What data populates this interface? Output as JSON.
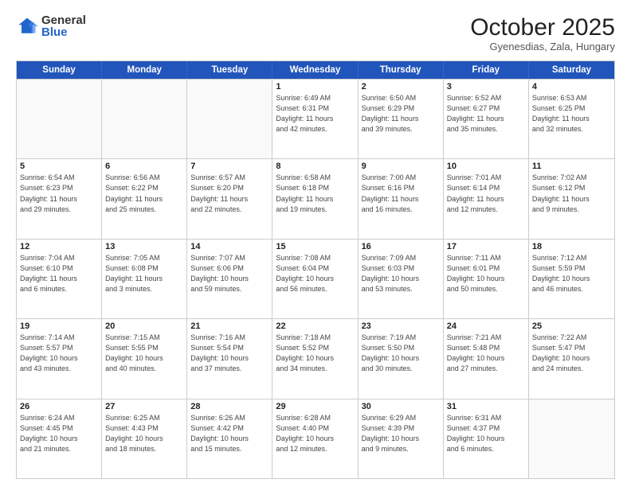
{
  "logo": {
    "general": "General",
    "blue": "Blue"
  },
  "header": {
    "month": "October 2025",
    "location": "Gyenesdias, Zala, Hungary"
  },
  "weekdays": [
    "Sunday",
    "Monday",
    "Tuesday",
    "Wednesday",
    "Thursday",
    "Friday",
    "Saturday"
  ],
  "rows": [
    [
      {
        "day": "",
        "info": ""
      },
      {
        "day": "",
        "info": ""
      },
      {
        "day": "",
        "info": ""
      },
      {
        "day": "1",
        "info": "Sunrise: 6:49 AM\nSunset: 6:31 PM\nDaylight: 11 hours\nand 42 minutes."
      },
      {
        "day": "2",
        "info": "Sunrise: 6:50 AM\nSunset: 6:29 PM\nDaylight: 11 hours\nand 39 minutes."
      },
      {
        "day": "3",
        "info": "Sunrise: 6:52 AM\nSunset: 6:27 PM\nDaylight: 11 hours\nand 35 minutes."
      },
      {
        "day": "4",
        "info": "Sunrise: 6:53 AM\nSunset: 6:25 PM\nDaylight: 11 hours\nand 32 minutes."
      }
    ],
    [
      {
        "day": "5",
        "info": "Sunrise: 6:54 AM\nSunset: 6:23 PM\nDaylight: 11 hours\nand 29 minutes."
      },
      {
        "day": "6",
        "info": "Sunrise: 6:56 AM\nSunset: 6:22 PM\nDaylight: 11 hours\nand 25 minutes."
      },
      {
        "day": "7",
        "info": "Sunrise: 6:57 AM\nSunset: 6:20 PM\nDaylight: 11 hours\nand 22 minutes."
      },
      {
        "day": "8",
        "info": "Sunrise: 6:58 AM\nSunset: 6:18 PM\nDaylight: 11 hours\nand 19 minutes."
      },
      {
        "day": "9",
        "info": "Sunrise: 7:00 AM\nSunset: 6:16 PM\nDaylight: 11 hours\nand 16 minutes."
      },
      {
        "day": "10",
        "info": "Sunrise: 7:01 AM\nSunset: 6:14 PM\nDaylight: 11 hours\nand 12 minutes."
      },
      {
        "day": "11",
        "info": "Sunrise: 7:02 AM\nSunset: 6:12 PM\nDaylight: 11 hours\nand 9 minutes."
      }
    ],
    [
      {
        "day": "12",
        "info": "Sunrise: 7:04 AM\nSunset: 6:10 PM\nDaylight: 11 hours\nand 6 minutes."
      },
      {
        "day": "13",
        "info": "Sunrise: 7:05 AM\nSunset: 6:08 PM\nDaylight: 11 hours\nand 3 minutes."
      },
      {
        "day": "14",
        "info": "Sunrise: 7:07 AM\nSunset: 6:06 PM\nDaylight: 10 hours\nand 59 minutes."
      },
      {
        "day": "15",
        "info": "Sunrise: 7:08 AM\nSunset: 6:04 PM\nDaylight: 10 hours\nand 56 minutes."
      },
      {
        "day": "16",
        "info": "Sunrise: 7:09 AM\nSunset: 6:03 PM\nDaylight: 10 hours\nand 53 minutes."
      },
      {
        "day": "17",
        "info": "Sunrise: 7:11 AM\nSunset: 6:01 PM\nDaylight: 10 hours\nand 50 minutes."
      },
      {
        "day": "18",
        "info": "Sunrise: 7:12 AM\nSunset: 5:59 PM\nDaylight: 10 hours\nand 46 minutes."
      }
    ],
    [
      {
        "day": "19",
        "info": "Sunrise: 7:14 AM\nSunset: 5:57 PM\nDaylight: 10 hours\nand 43 minutes."
      },
      {
        "day": "20",
        "info": "Sunrise: 7:15 AM\nSunset: 5:55 PM\nDaylight: 10 hours\nand 40 minutes."
      },
      {
        "day": "21",
        "info": "Sunrise: 7:16 AM\nSunset: 5:54 PM\nDaylight: 10 hours\nand 37 minutes."
      },
      {
        "day": "22",
        "info": "Sunrise: 7:18 AM\nSunset: 5:52 PM\nDaylight: 10 hours\nand 34 minutes."
      },
      {
        "day": "23",
        "info": "Sunrise: 7:19 AM\nSunset: 5:50 PM\nDaylight: 10 hours\nand 30 minutes."
      },
      {
        "day": "24",
        "info": "Sunrise: 7:21 AM\nSunset: 5:48 PM\nDaylight: 10 hours\nand 27 minutes."
      },
      {
        "day": "25",
        "info": "Sunrise: 7:22 AM\nSunset: 5:47 PM\nDaylight: 10 hours\nand 24 minutes."
      }
    ],
    [
      {
        "day": "26",
        "info": "Sunrise: 6:24 AM\nSunset: 4:45 PM\nDaylight: 10 hours\nand 21 minutes."
      },
      {
        "day": "27",
        "info": "Sunrise: 6:25 AM\nSunset: 4:43 PM\nDaylight: 10 hours\nand 18 minutes."
      },
      {
        "day": "28",
        "info": "Sunrise: 6:26 AM\nSunset: 4:42 PM\nDaylight: 10 hours\nand 15 minutes."
      },
      {
        "day": "29",
        "info": "Sunrise: 6:28 AM\nSunset: 4:40 PM\nDaylight: 10 hours\nand 12 minutes."
      },
      {
        "day": "30",
        "info": "Sunrise: 6:29 AM\nSunset: 4:39 PM\nDaylight: 10 hours\nand 9 minutes."
      },
      {
        "day": "31",
        "info": "Sunrise: 6:31 AM\nSunset: 4:37 PM\nDaylight: 10 hours\nand 6 minutes."
      },
      {
        "day": "",
        "info": ""
      }
    ]
  ]
}
